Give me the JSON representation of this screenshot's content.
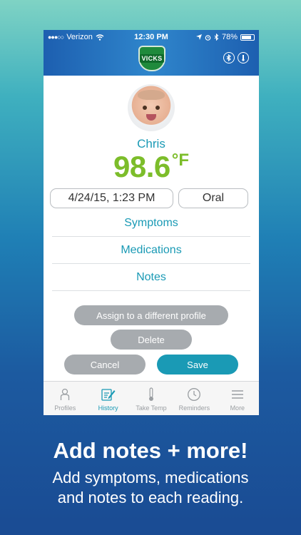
{
  "status_bar": {
    "carrier": "Verizon",
    "time": "12:30 PM",
    "battery": "78%"
  },
  "header": {
    "logo_text": "VICKS"
  },
  "reading": {
    "name": "Chris",
    "temperature": "98.6",
    "unit": "°F",
    "date_time": "4/24/15, 1:23 PM",
    "method": "Oral"
  },
  "menu": {
    "symptoms": "Symptoms",
    "medications": "Medications",
    "notes": "Notes"
  },
  "buttons": {
    "assign": "Assign to a different profile",
    "delete": "Delete",
    "cancel": "Cancel",
    "save": "Save"
  },
  "tabs": [
    {
      "label": "Profiles"
    },
    {
      "label": "History"
    },
    {
      "label": "Take Temp"
    },
    {
      "label": "Reminders"
    },
    {
      "label": "More"
    }
  ],
  "promo": {
    "title": "Add notes + more!",
    "subtitle_line1": "Add symptoms, medications",
    "subtitle_line2": "and notes to each reading."
  },
  "colors": {
    "accent": "#1a9ab5",
    "temperature": "#7cbd2a",
    "header": "#2f86cc"
  }
}
